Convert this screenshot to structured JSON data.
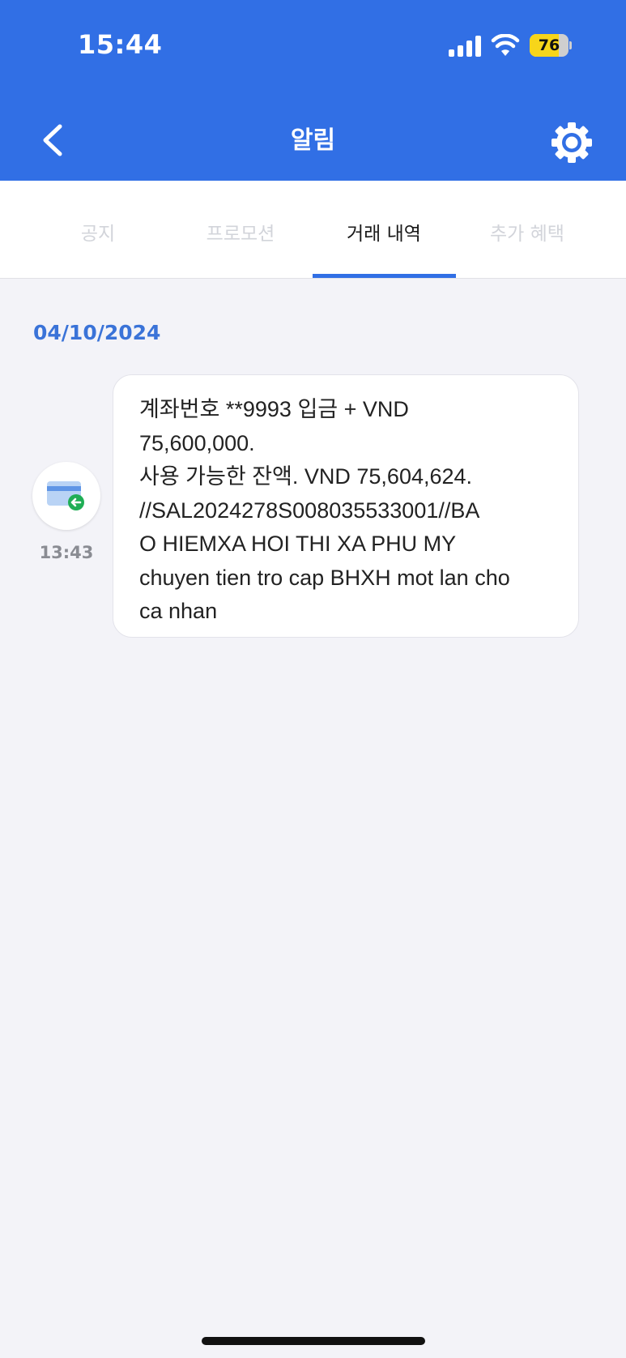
{
  "status_bar": {
    "time": "15:44",
    "signal_icon": "cellular-signal-icon",
    "wifi_icon": "wifi-icon",
    "battery_level": "76",
    "battery_fraction": 0.76
  },
  "header": {
    "title": "알림",
    "back_icon": "chevron-left-icon",
    "settings_icon": "gear-icon"
  },
  "tabs": [
    {
      "label": "공지",
      "active": false
    },
    {
      "label": "프로모션",
      "active": false
    },
    {
      "label": "거래 내역",
      "active": true
    },
    {
      "label": "추가 혜택",
      "active": false
    }
  ],
  "date_group": {
    "date": "04/10/2024",
    "message": {
      "icon": "card-incoming-icon",
      "time": "13:43",
      "lines": [
        "계좌번호 **9993 입금 + VND",
        "75,600,000.",
        "사용 가능한 잔액. VND 75,604,624.",
        "//SAL2024278S008035533001//BA",
        "O HIEMXA HOI THI XA PHU MY",
        "chuyen tien tro cap BHXH mot lan cho",
        "ca nhan"
      ]
    }
  },
  "colors": {
    "brand": "#316fe5",
    "date_text": "#3a73d8",
    "background": "#f3f3f8",
    "battery": "#f7d51a"
  }
}
